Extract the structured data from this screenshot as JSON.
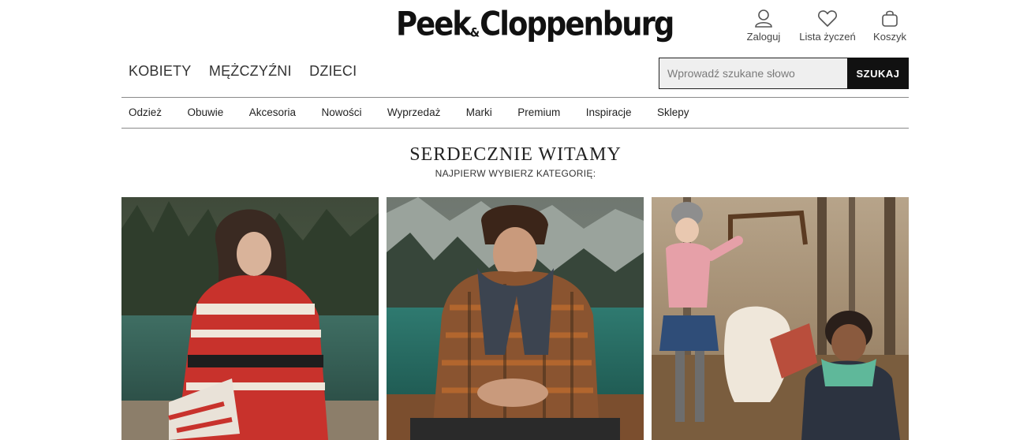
{
  "brand": {
    "logo_left": "Peek",
    "logo_amp": "&",
    "logo_right": "Cloppenburg"
  },
  "account": {
    "login_label": "Zaloguj",
    "wishlist_label": "Lista życzeń",
    "cart_label": "Koszyk"
  },
  "main_nav": [
    "KOBIETY",
    "MĘŻCZYŹNI",
    "DZIECI"
  ],
  "search": {
    "placeholder": "Wprowadź szukane słowo",
    "button_label": "SZUKAJ"
  },
  "sub_nav": [
    "Odzież",
    "Obuwie",
    "Akcesoria",
    "Nowości",
    "Wyprzedaż",
    "Marki",
    "Premium",
    "Inspiracje",
    "Sklepy"
  ],
  "welcome": {
    "title": "SERDECZNIE WITAMY",
    "subtitle": "NAJPIERW WYBIERZ KATEGORIĘ:"
  },
  "colors": {
    "text": "#222222",
    "search_button": "#111111",
    "search_bg": "#efefef",
    "rule": "#8a8a8a"
  }
}
